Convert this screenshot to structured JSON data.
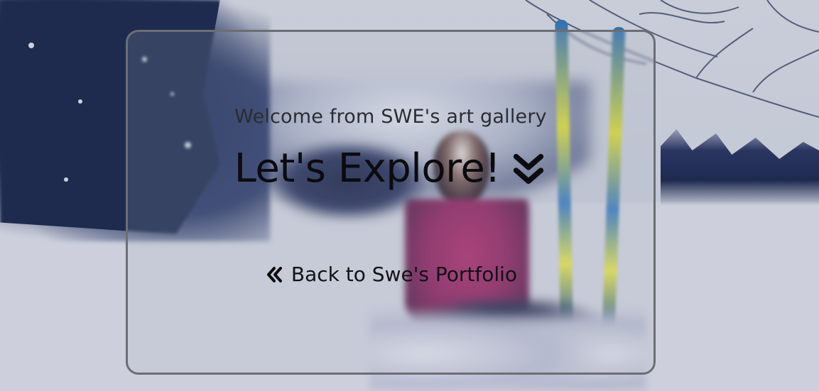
{
  "hero": {
    "background_description_colors": {
      "sky": "#c9cdd8",
      "trees": "#1e2b4f",
      "jacket": "#8c2460",
      "ski": "#2f6fb0"
    },
    "welcome_text": "Welcome from SWE's art gallery",
    "headline": "Let's Explore!",
    "headline_icon": "double-chevron-down-icon",
    "back_link": {
      "label": "Back to Swe's Portfolio",
      "icon": "double-chevron-left-icon"
    }
  },
  "colors": {
    "card_border": "#6c6e75",
    "text_primary": "#0b0b10",
    "text_secondary": "#2b2c33"
  }
}
